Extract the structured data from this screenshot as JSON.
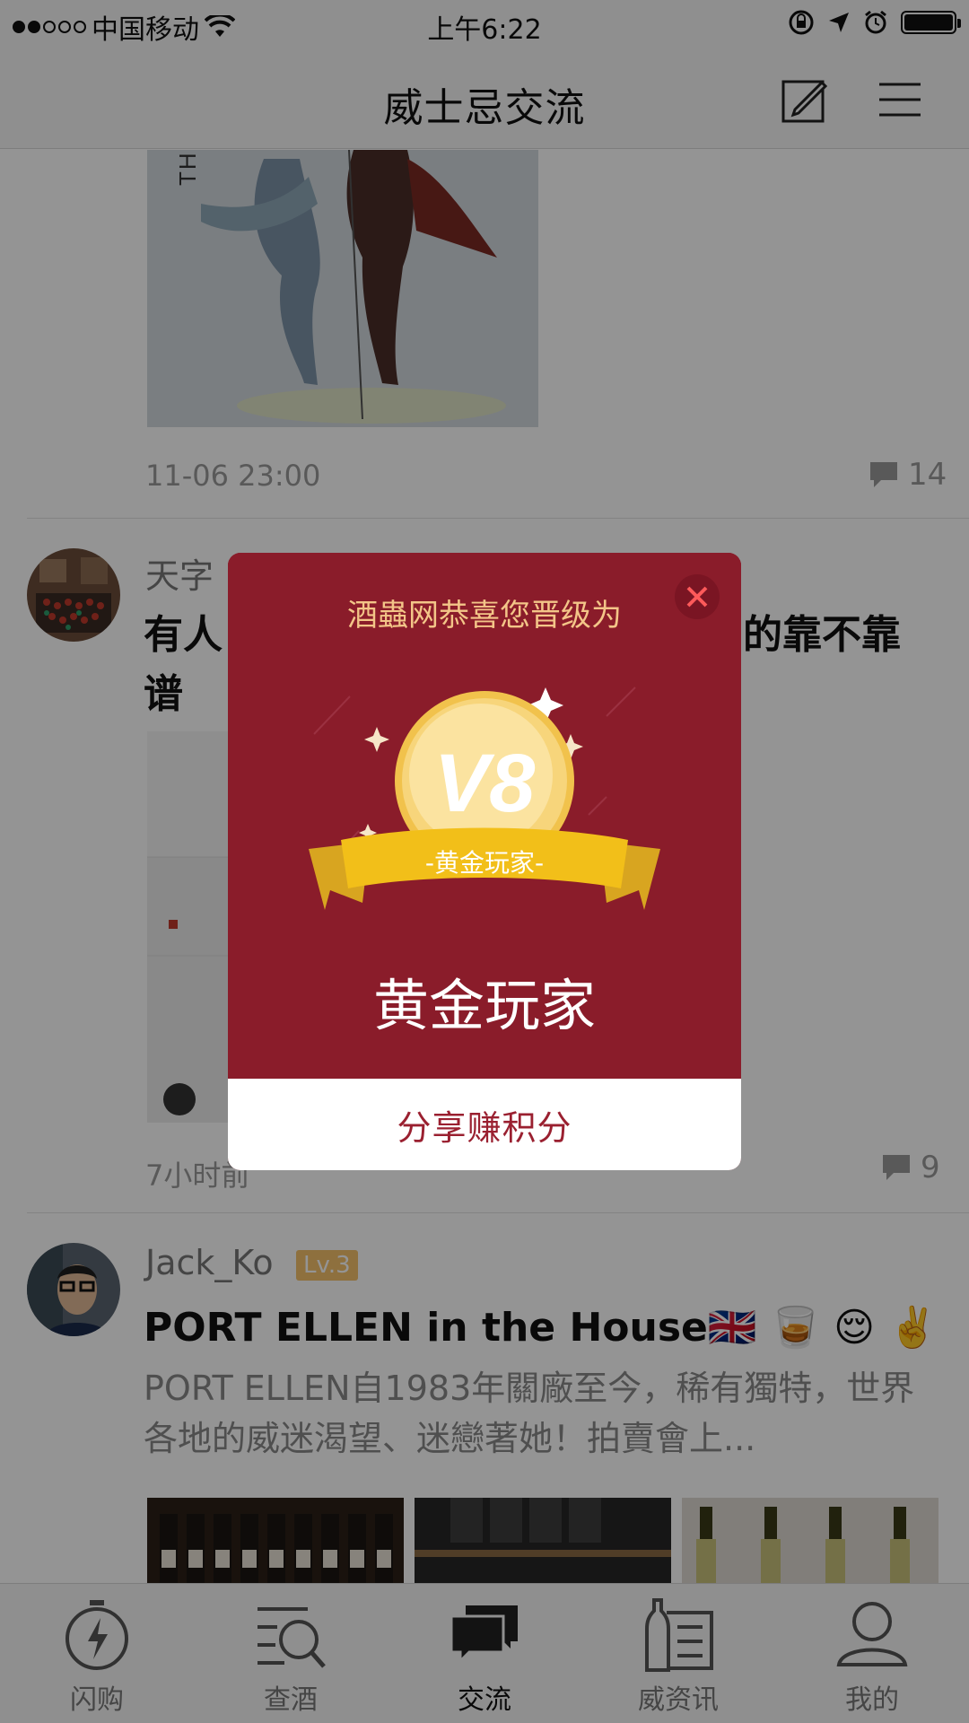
{
  "status_bar": {
    "carrier": "中国移动",
    "time": "上午6:22"
  },
  "nav": {
    "title": "威士忌交流",
    "compose_icon": "compose-icon",
    "menu_icon": "menu-icon"
  },
  "feed": {
    "posts": [
      {
        "time": "11-06 23:00",
        "comments": "14",
        "image_text": "THE WHISKY"
      },
      {
        "user": "天字",
        "title_start": "有人",
        "title_end": "的靠不靠",
        "title_line2": "谱",
        "time": "7小时前",
        "comments": "9"
      },
      {
        "user": "Jack_Ko",
        "level": "Lv.3",
        "title": "PORT ELLEN in the House🇬🇧 🥃 😌 ✌️",
        "body": "PORT ELLEN自1983年關廠至今，稀有獨特，世界各地的威迷渴望、迷戀著她！拍賣會上..."
      }
    ]
  },
  "modal": {
    "subtitle": "酒蟲网恭喜您晋级为",
    "badge_level": "V8",
    "ribbon_text": "-黄金玩家-",
    "level_name": "黄金玩家",
    "share_label": "分享赚积分"
  },
  "tabbar": {
    "tabs": [
      {
        "label": "闪购",
        "icon": "flash-icon"
      },
      {
        "label": "查酒",
        "icon": "search-wine-icon"
      },
      {
        "label": "交流",
        "icon": "chat-icon"
      },
      {
        "label": "威资讯",
        "icon": "news-icon"
      },
      {
        "label": "我的",
        "icon": "profile-icon"
      }
    ],
    "active_index": 2
  }
}
